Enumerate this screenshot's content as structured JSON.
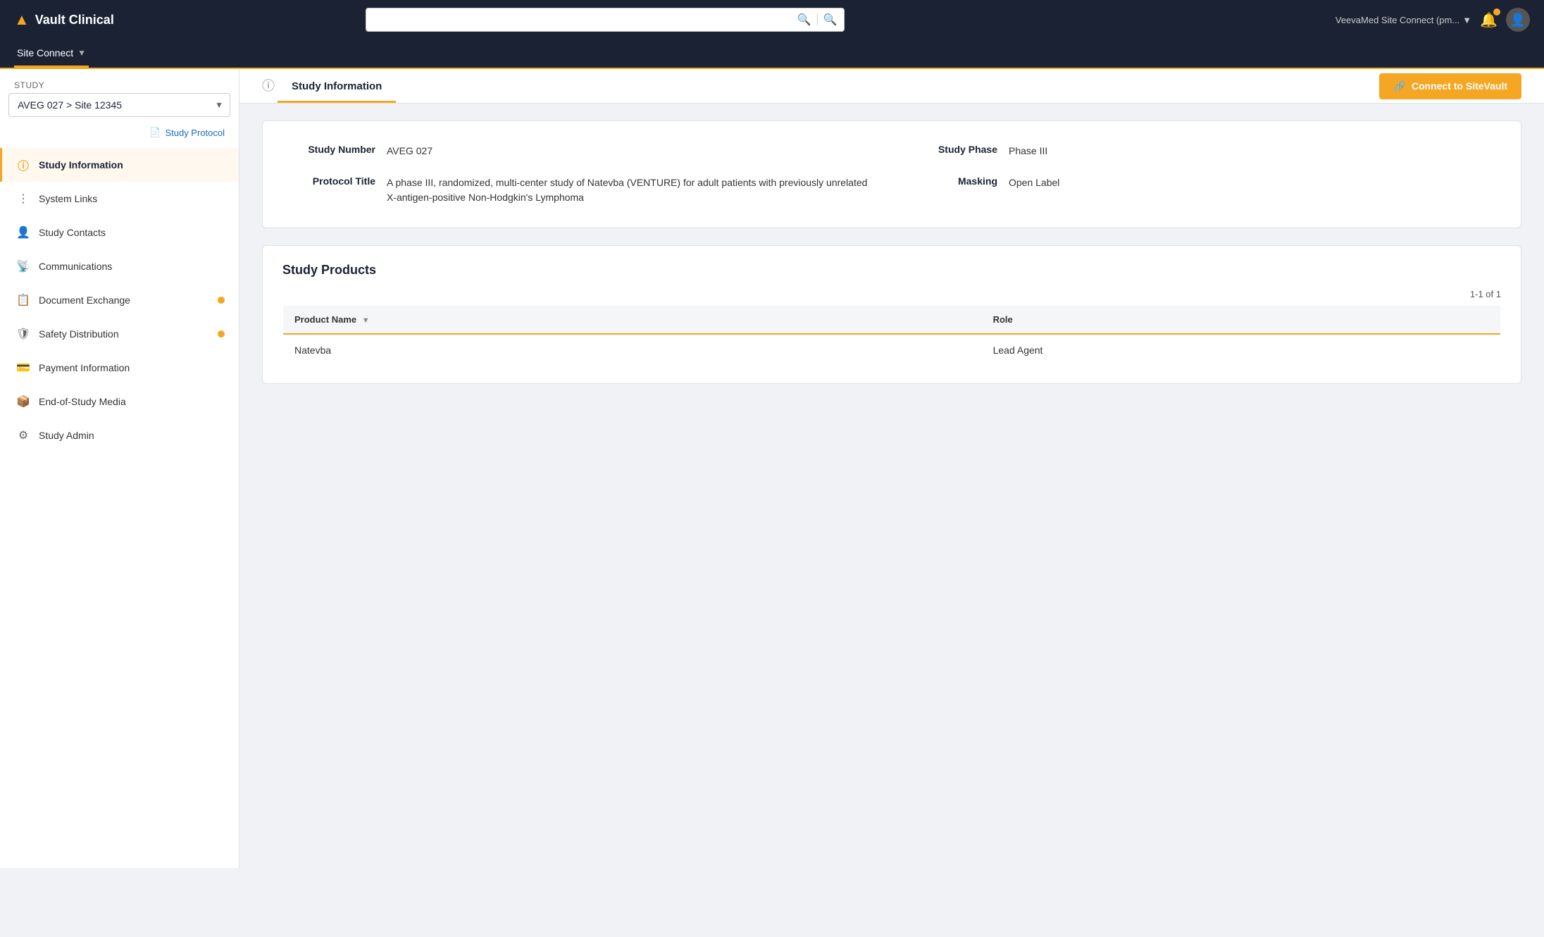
{
  "app": {
    "name": "Vault Clinical",
    "logo_text": "Vault Clinical"
  },
  "top_nav": {
    "search_placeholder": "",
    "user_label": "VeevaMed Site Connect (pm...",
    "user_dropdown_icon": "▾"
  },
  "sub_nav": {
    "item_label": "Site Connect",
    "chevron": "▾"
  },
  "sidebar": {
    "study_label": "Study",
    "study_select_value": "AVEG 027 > Site 12345",
    "protocol_link": "Study Protocol",
    "nav_items": [
      {
        "id": "study-information",
        "label": "Study Information",
        "icon": "ℹ",
        "active": true,
        "badge": false
      },
      {
        "id": "system-links",
        "label": "System Links",
        "icon": "⊞",
        "active": false,
        "badge": false
      },
      {
        "id": "study-contacts",
        "label": "Study Contacts",
        "icon": "👤",
        "active": false,
        "badge": false
      },
      {
        "id": "communications",
        "label": "Communications",
        "icon": "📡",
        "active": false,
        "badge": false
      },
      {
        "id": "document-exchange",
        "label": "Document Exchange",
        "icon": "📋",
        "active": false,
        "badge": true
      },
      {
        "id": "safety-distribution",
        "label": "Safety Distribution",
        "icon": "🛡",
        "active": false,
        "badge": true
      },
      {
        "id": "payment-information",
        "label": "Payment Information",
        "icon": "💳",
        "active": false,
        "badge": false
      },
      {
        "id": "end-of-study-media",
        "label": "End-of-Study Media",
        "icon": "📦",
        "active": false,
        "badge": false
      },
      {
        "id": "study-admin",
        "label": "Study Admin",
        "icon": "⚙",
        "active": false,
        "badge": false
      }
    ]
  },
  "page_header": {
    "tab_label": "Study Information",
    "connect_button": "Connect to SiteVault",
    "info_icon": "ℹ"
  },
  "study_info": {
    "study_number_label": "Study Number",
    "study_number_value": "AVEG 027",
    "study_phase_label": "Study Phase",
    "study_phase_value": "Phase III",
    "protocol_title_label": "Protocol Title",
    "protocol_title_value": "A phase III, randomized, multi-center study of Natevba (VENTURE) for adult patients with previously unrelated X-antigen-positive Non-Hodgkin's Lymphoma",
    "masking_label": "Masking",
    "masking_value": "Open Label"
  },
  "study_products": {
    "section_title": "Study Products",
    "count_text": "1-1 of 1",
    "columns": [
      {
        "label": "Product Name",
        "sortable": true
      },
      {
        "label": "Role",
        "sortable": false
      }
    ],
    "rows": [
      {
        "product_name": "Natevba",
        "role": "Lead Agent"
      }
    ]
  }
}
